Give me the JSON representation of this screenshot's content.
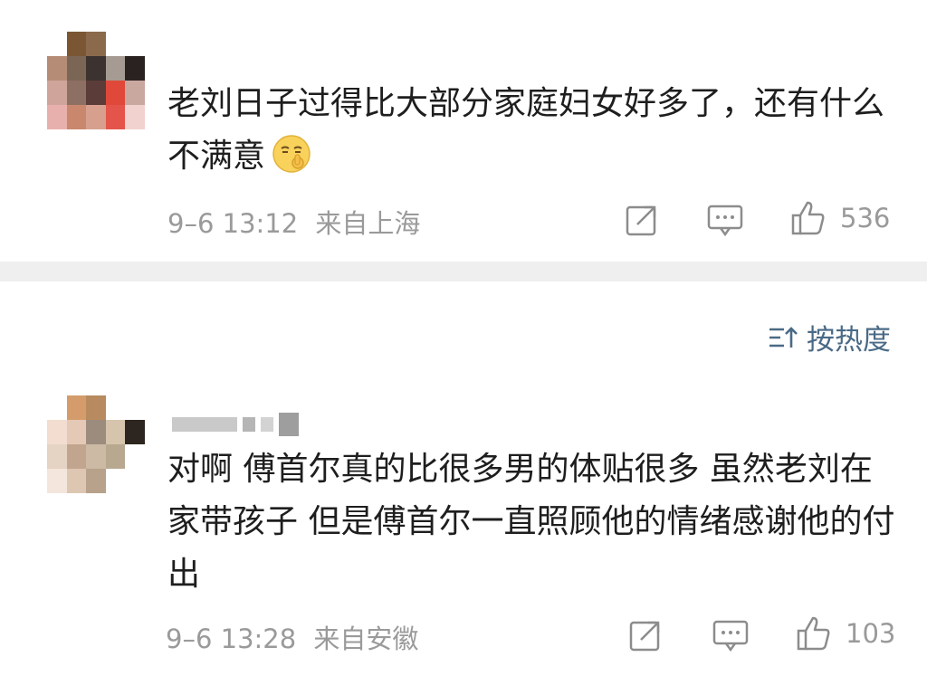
{
  "comments": [
    {
      "text": "老刘日子过得比大部分家庭妇女好多了，还有什么不满意",
      "emoji": "shushing-face-emoji",
      "date": "9–6 13:12",
      "location": "来自上海",
      "likes": "536"
    },
    {
      "author": "",
      "text": "对啊 傅首尔真的比很多男的体贴很多 虽然老刘在家带孩子 但是傅首尔一直照顾他的情绪感谢他的付出",
      "date": "9–6 13:28",
      "location": "来自安徽",
      "likes": "103"
    }
  ],
  "sort": {
    "label": "按热度",
    "icon": "sort-icon"
  },
  "icons": {
    "share": "share-icon",
    "comment": "comment-icon",
    "like": "thumbs-up-icon"
  },
  "colors": {
    "text": "#1e1e1e",
    "meta": "#9a9a9a",
    "sort_accent": "#4a6a86",
    "divider": "#efefef"
  }
}
